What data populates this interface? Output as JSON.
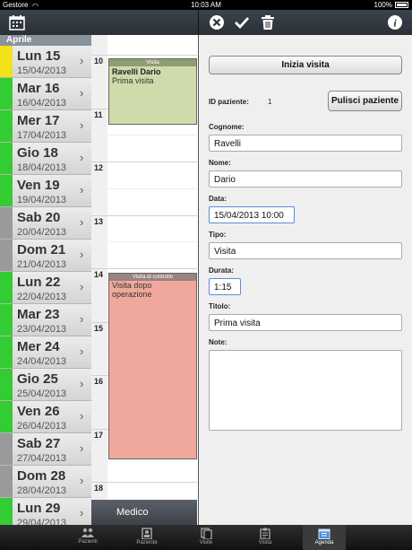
{
  "status_bar": {
    "carrier": "Gestore",
    "time": "10:03 AM",
    "battery": "100%"
  },
  "agenda": {
    "month": "Aprile",
    "days": [
      {
        "name": "Lun 15",
        "date": "15/04/2013",
        "color": "#f2e21a"
      },
      {
        "name": "Mar 16",
        "date": "16/04/2013",
        "color": "#33cc33"
      },
      {
        "name": "Mer 17",
        "date": "17/04/2013",
        "color": "#33cc33"
      },
      {
        "name": "Gio 18",
        "date": "18/04/2013",
        "color": "#33cc33"
      },
      {
        "name": "Ven 19",
        "date": "19/04/2013",
        "color": "#33cc33"
      },
      {
        "name": "Sab 20",
        "date": "20/04/2013",
        "color": "#9a9a9a"
      },
      {
        "name": "Dom 21",
        "date": "21/04/2013",
        "color": "#9a9a9a"
      },
      {
        "name": "Lun 22",
        "date": "22/04/2013",
        "color": "#33cc33"
      },
      {
        "name": "Mar 23",
        "date": "23/04/2013",
        "color": "#33cc33"
      },
      {
        "name": "Mer 24",
        "date": "24/04/2013",
        "color": "#33cc33"
      },
      {
        "name": "Gio 25",
        "date": "25/04/2013",
        "color": "#33cc33"
      },
      {
        "name": "Ven 26",
        "date": "26/04/2013",
        "color": "#33cc33"
      },
      {
        "name": "Sab 27",
        "date": "27/04/2013",
        "color": "#9a9a9a"
      },
      {
        "name": "Dom 28",
        "date": "28/04/2013",
        "color": "#9a9a9a"
      },
      {
        "name": "Lun 29",
        "date": "29/04/2013",
        "color": "#33cc33"
      }
    ],
    "hours": [
      "10",
      "11",
      "12",
      "13",
      "14",
      "15",
      "16",
      "17",
      "18"
    ],
    "events": [
      {
        "type": "Visita",
        "title": "Ravelli Dario",
        "subtitle": "Prima visita",
        "color": "#cddcaa",
        "header_color": "#8f9d74"
      },
      {
        "type": "Visita di controllo",
        "title": "",
        "subtitle": "Visita dopo operazione",
        "color": "#f0a89c",
        "header_color": "#9a8480"
      }
    ],
    "medico_label": "Medico"
  },
  "detail": {
    "start_visit_label": "Inizia visita",
    "patient_id_label": "ID paziente:",
    "patient_id_value": "1",
    "clear_patient_label": "Pulisci paziente",
    "fields": {
      "cognome": {
        "label": "Cognome:",
        "value": "Ravelli"
      },
      "nome": {
        "label": "Nome:",
        "value": "Dario"
      },
      "data": {
        "label": "Data:",
        "value": "15/04/2013 10:00"
      },
      "tipo": {
        "label": "Tipo:",
        "value": "Visita"
      },
      "durata": {
        "label": "Durata:",
        "value": "1:15"
      },
      "titolo": {
        "label": "Titolo:",
        "value": "Prima visita"
      },
      "note": {
        "label": "Note:",
        "value": ""
      }
    }
  },
  "toolbar_icons": [
    "calendar-icon",
    "close-circle-icon",
    "checkmark-icon",
    "trash-icon",
    "info-icon"
  ],
  "tabs": [
    {
      "label": "Pazienti",
      "icon": "people-icon"
    },
    {
      "label": "Paziente",
      "icon": "badge-icon"
    },
    {
      "label": "Visite",
      "icon": "documents-icon"
    },
    {
      "label": "Visita",
      "icon": "clipboard-icon"
    },
    {
      "label": "Agenda",
      "icon": "calendar-icon",
      "active": true
    }
  ]
}
